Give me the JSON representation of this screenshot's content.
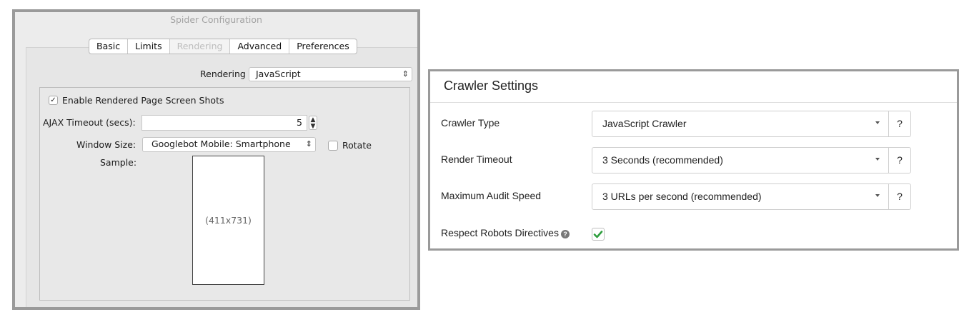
{
  "spider": {
    "window_title": "Spider Configuration",
    "tabs": [
      {
        "label": "Basic",
        "disabled": false
      },
      {
        "label": "Limits",
        "disabled": false
      },
      {
        "label": "Rendering",
        "disabled": true
      },
      {
        "label": "Advanced",
        "disabled": false
      },
      {
        "label": "Preferences",
        "disabled": false
      }
    ],
    "rendering_label": "Rendering",
    "rendering_value": "JavaScript",
    "screenshots_checkbox": {
      "label": "Enable Rendered Page Screen Shots",
      "checked": true
    },
    "ajax_timeout": {
      "label": "AJAX Timeout (secs):",
      "value": "5"
    },
    "window_size": {
      "label": "Window Size:",
      "value": "Googlebot Mobile: Smartphone"
    },
    "rotate_checkbox": {
      "label": "Rotate",
      "checked": false
    },
    "sample": {
      "label": "Sample:",
      "dimensions": "(411x731)"
    }
  },
  "crawler": {
    "title": "Crawler Settings",
    "rows": [
      {
        "label": "Crawler Type",
        "value": "JavaScript Crawler",
        "help": "?"
      },
      {
        "label": "Render Timeout",
        "value": "3 Seconds (recommended)",
        "help": "?"
      },
      {
        "label": "Maximum Audit Speed",
        "value": "3 URLs per second (recommended)",
        "help": "?"
      }
    ],
    "robots": {
      "label": "Respect Robots Directives",
      "info_icon": "?",
      "checked": true,
      "check_color": "#2e9e3e"
    }
  }
}
